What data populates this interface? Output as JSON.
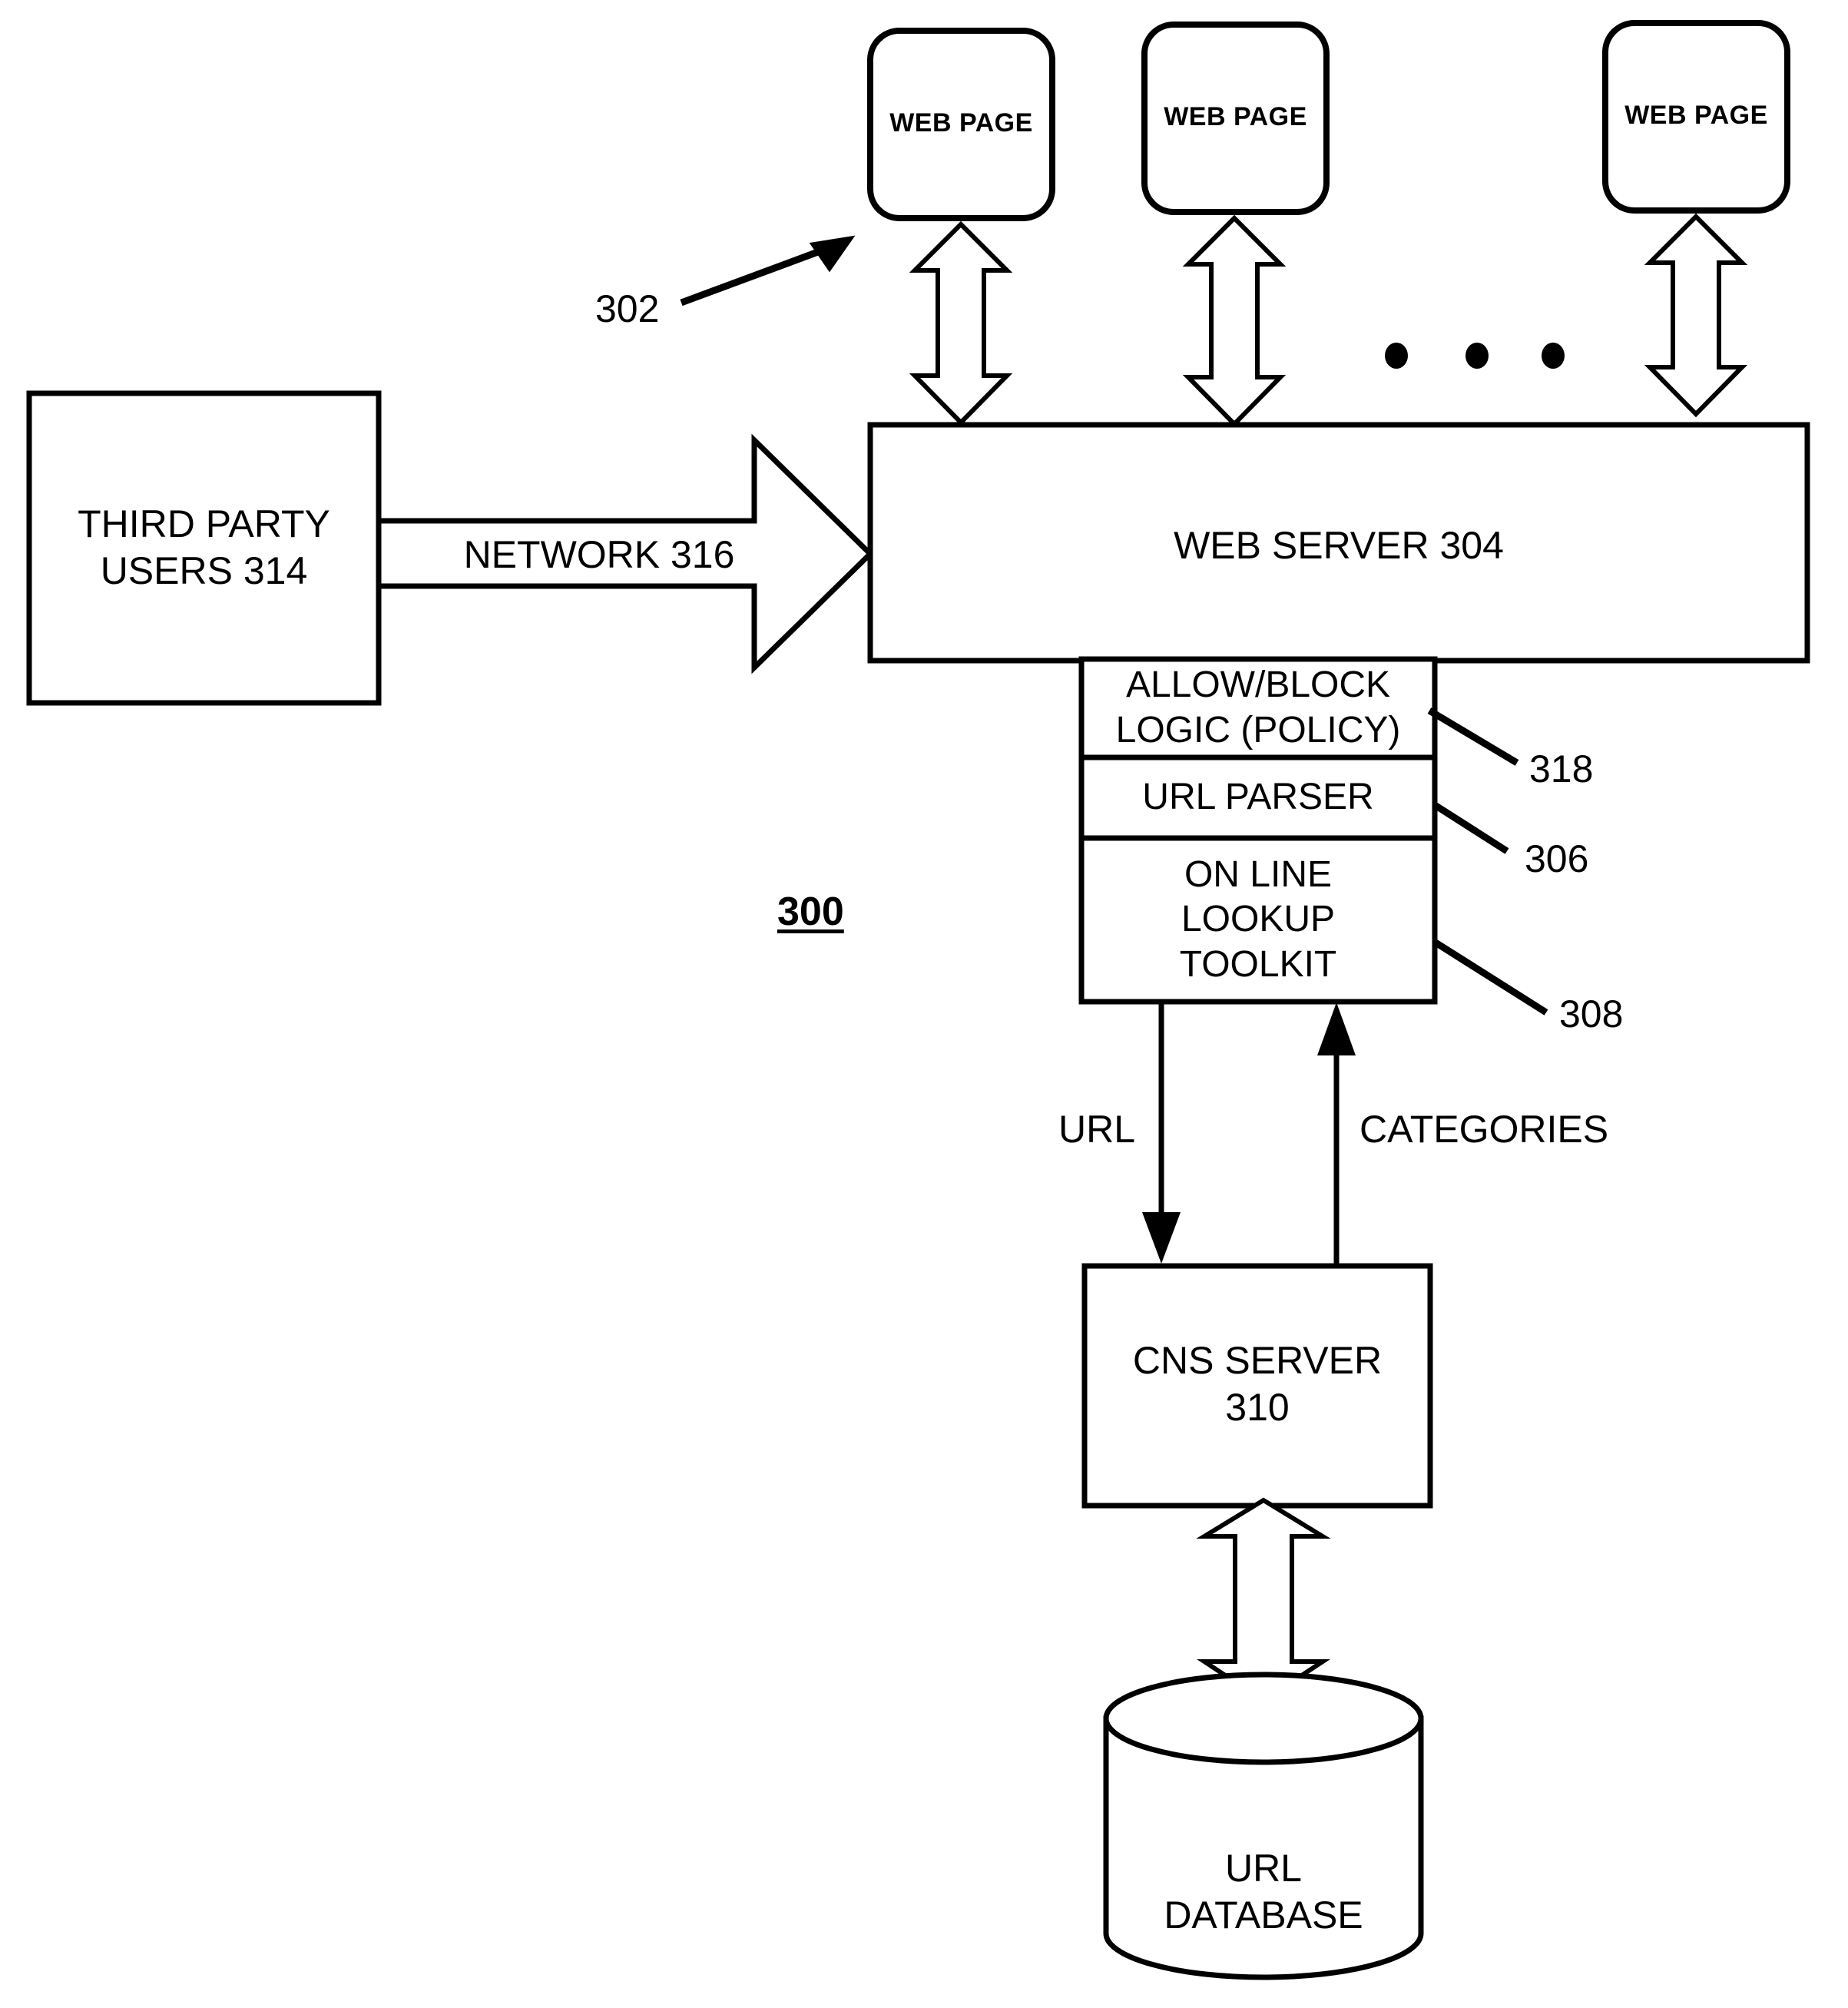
{
  "figure": {
    "number": "300",
    "title_label": "300"
  },
  "nodes": {
    "web_pages": [
      {
        "label": "WEB PAGE"
      },
      {
        "label": "WEB PAGE"
      },
      {
        "label": "WEB PAGE"
      }
    ],
    "third_party_users": {
      "label": "THIRD PARTY\nUSERS 314"
    },
    "network": {
      "label": "NETWORK 316"
    },
    "web_server": {
      "label": "WEB SERVER 304"
    },
    "allow_block_logic": {
      "label": "ALLOW/BLOCK\nLOGIC (POLICY)"
    },
    "url_parser": {
      "label": "URL PARSER"
    },
    "online_lookup_toolkit": {
      "label": "ON LINE\nLOOKUP\nTOOLKIT"
    },
    "cns_server": {
      "label": "CNS SERVER\n310"
    },
    "url_database": {
      "label": "URL\nDATABASE"
    }
  },
  "reference_numerals": {
    "pointer_302": "302",
    "allow_block_logic_318": "318",
    "url_parser_306": "306",
    "online_lookup_toolkit_308": "308"
  },
  "edge_labels": {
    "url_down": "URL",
    "categories_up": "CATEGORIES"
  },
  "ellipsis": {
    "dots": 3
  },
  "colors": {
    "stroke": "#000000",
    "background": "#ffffff",
    "text": "#000000"
  }
}
